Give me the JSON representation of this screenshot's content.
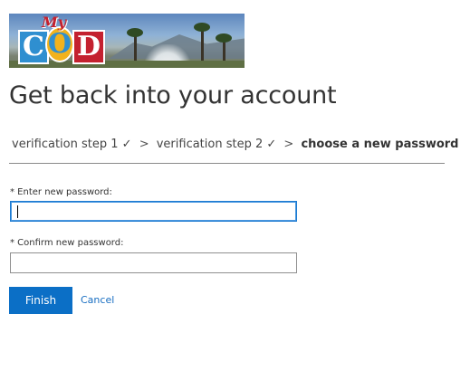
{
  "header": {
    "logo_small_text": "My",
    "logo_letters": [
      "C",
      "O",
      "D"
    ]
  },
  "page": {
    "title": "Get back into your account"
  },
  "steps": {
    "step1": "verification step 1 ✓",
    "separator": ">",
    "step2": "verification step 2 ✓",
    "current": "choose a new password"
  },
  "form": {
    "new_password_label": "* Enter new password:",
    "new_password_value": "",
    "confirm_password_label": "* Confirm new password:",
    "confirm_password_value": "",
    "finish_label": "Finish",
    "cancel_label": "Cancel"
  },
  "colors": {
    "primary_button": "#0b6fc6",
    "link": "#1a6fc2",
    "focus_border": "#1c7ad1"
  }
}
